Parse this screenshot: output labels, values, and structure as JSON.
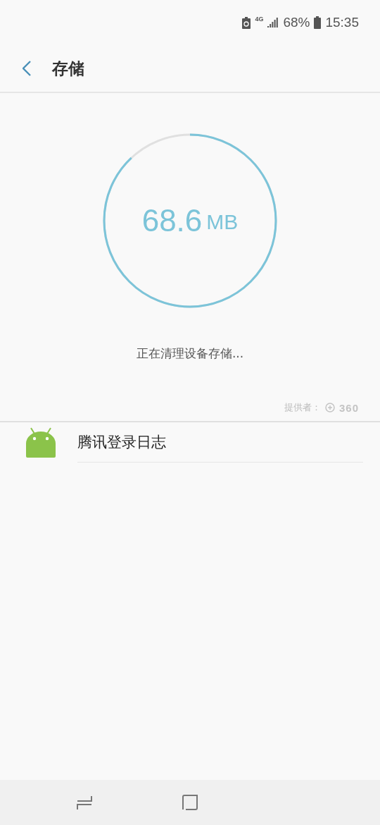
{
  "status_bar": {
    "network": "4G",
    "battery": "68%",
    "time": "15:35"
  },
  "header": {
    "title": "存储"
  },
  "cleaner": {
    "amount": "68.6",
    "unit": "MB",
    "status": "正在清理设备存储..."
  },
  "provider": {
    "label": "提供者：",
    "logo": "360"
  },
  "items": [
    {
      "name": "腾讯登录日志"
    }
  ]
}
